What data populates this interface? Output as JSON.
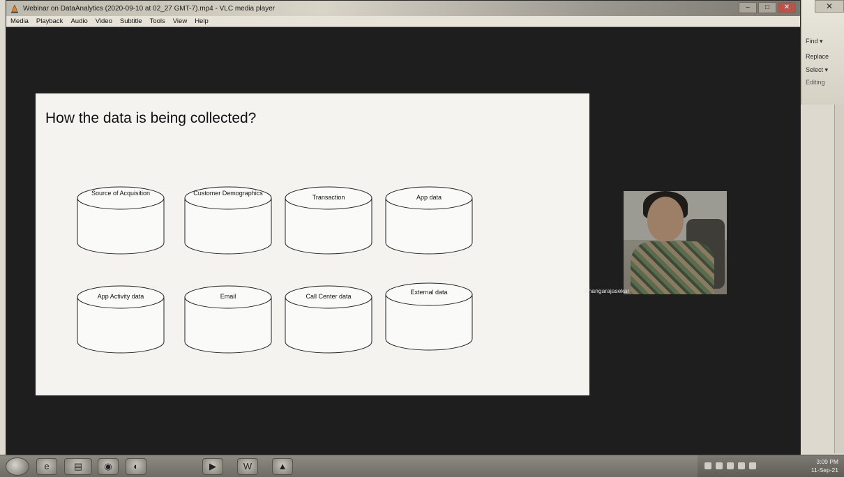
{
  "window": {
    "title": "Webinar on DataAnalytics (2020-09-10 at 02_27 GMT-7).mp4 - VLC media player"
  },
  "menu": [
    "Media",
    "Playback",
    "Audio",
    "Video",
    "Subtitle",
    "Tools",
    "View",
    "Help"
  ],
  "slide": {
    "title": "How the data is being collected?",
    "databases": [
      "Source of Acquisition",
      "Customer Demographics",
      "Transaction",
      "App data",
      "App Activity data",
      "Email",
      "Call Center data",
      "External data"
    ]
  },
  "webcam": {
    "participant_name": "Anangarajasekar"
  },
  "background_app": {
    "ribbon": [
      "Find ▾",
      "Replace",
      "Select ▾",
      "Editing"
    ]
  },
  "taskbar": {
    "time": "3:09 PM",
    "date": "11-Sep-21"
  },
  "icons": {
    "vlc": "vlc-cone-icon",
    "start": "windows-start-icon"
  }
}
